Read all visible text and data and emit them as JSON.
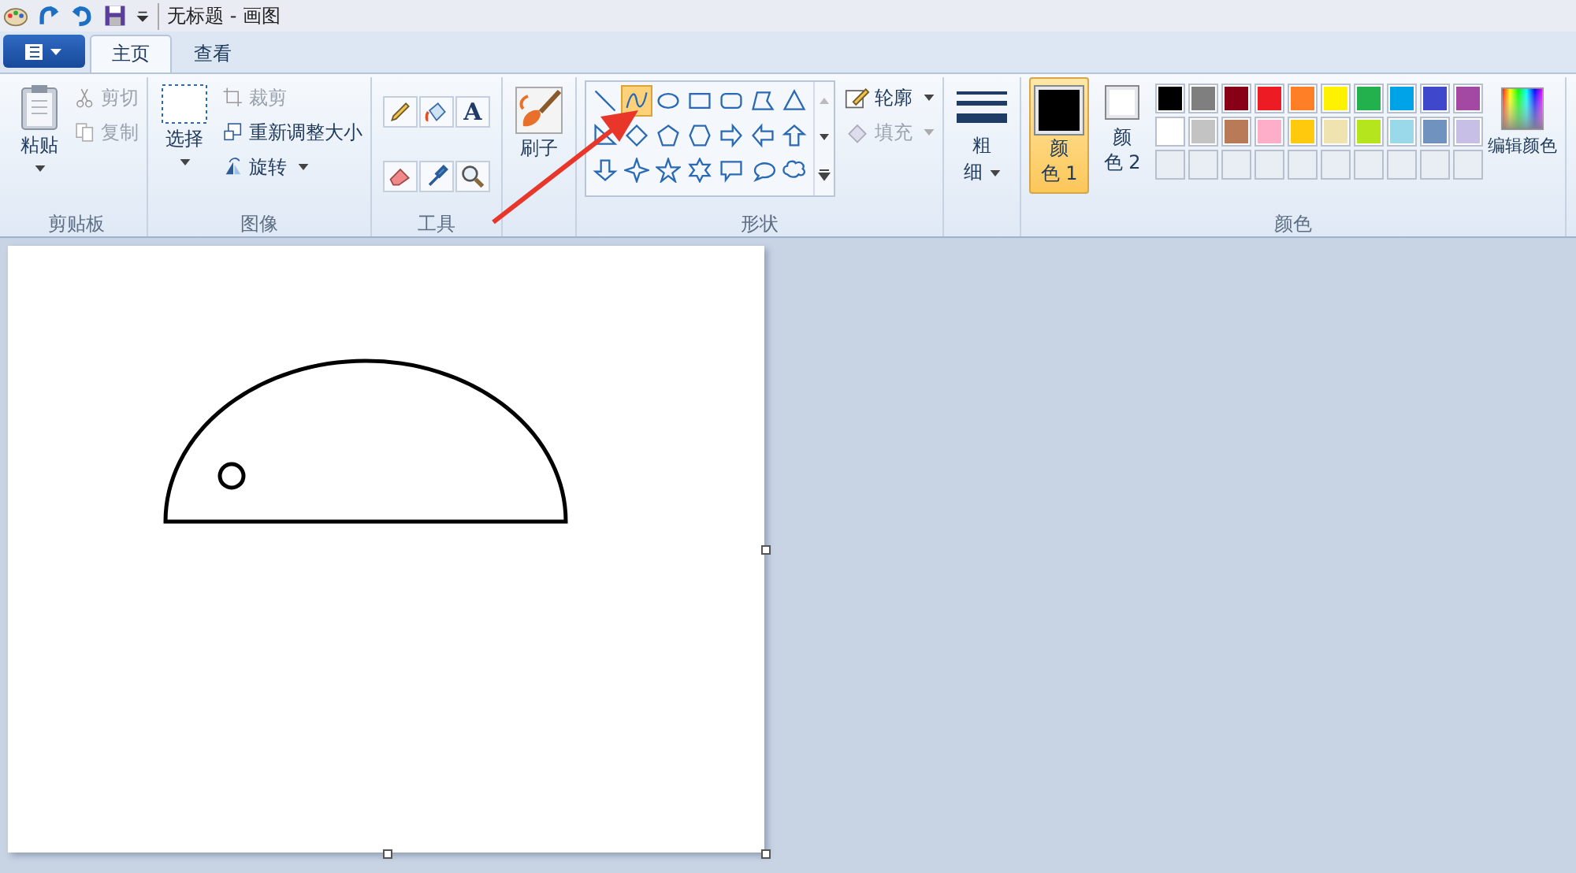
{
  "window": {
    "title": "无标题 - 画图"
  },
  "tabs": [
    {
      "label": "主页",
      "selected": true
    },
    {
      "label": "查看",
      "selected": false
    }
  ],
  "clipboard": {
    "label": "剪贴板",
    "paste": "粘贴",
    "actions": [
      {
        "kind": "cut",
        "label": "剪切",
        "disabled": true
      },
      {
        "kind": "copy",
        "label": "复制",
        "disabled": true
      }
    ]
  },
  "image": {
    "label": "图像",
    "select": "选择",
    "actions": [
      {
        "kind": "crop",
        "label": "裁剪",
        "disabled": true
      },
      {
        "kind": "resize",
        "label": "重新调整大小",
        "disabled": false
      },
      {
        "kind": "rotate",
        "label": "旋转",
        "disabled": false
      }
    ]
  },
  "tools": {
    "label": "工具",
    "items": [
      {
        "kind": "pencil"
      },
      {
        "kind": "bucket"
      },
      {
        "kind": "text",
        "glyph": "A"
      },
      {
        "kind": "eraser"
      },
      {
        "kind": "picker"
      },
      {
        "kind": "magnifier"
      }
    ]
  },
  "brush": {
    "label": "刷子"
  },
  "shapes": {
    "label": "形状",
    "items": [
      {
        "kind": "line",
        "selected": false
      },
      {
        "kind": "curve",
        "selected": true
      },
      {
        "kind": "oval",
        "selected": false
      },
      {
        "kind": "rect",
        "selected": false
      },
      {
        "kind": "roundrect",
        "selected": false
      },
      {
        "kind": "polygon",
        "selected": false
      },
      {
        "kind": "triangle",
        "selected": false
      },
      {
        "kind": "right-triangle",
        "selected": false
      },
      {
        "kind": "diamond",
        "selected": false
      },
      {
        "kind": "pentagon",
        "selected": false
      },
      {
        "kind": "hexagon",
        "selected": false
      },
      {
        "kind": "right-arrow",
        "selected": false
      },
      {
        "kind": "left-arrow",
        "selected": false
      },
      {
        "kind": "up-arrow",
        "selected": false
      },
      {
        "kind": "down-arrow",
        "selected": false
      },
      {
        "kind": "star4",
        "selected": false
      },
      {
        "kind": "star5",
        "selected": false
      },
      {
        "kind": "star6",
        "selected": false
      },
      {
        "kind": "callout-rect",
        "selected": false
      },
      {
        "kind": "callout-oval",
        "selected": false
      },
      {
        "kind": "callout-cloud",
        "selected": false
      }
    ],
    "outline": {
      "label": "轮廓",
      "disabled": false
    },
    "fill": {
      "label": "填充",
      "disabled": true
    }
  },
  "size": {
    "label_top": "粗",
    "label_bottom": "细"
  },
  "colors": {
    "label": "颜色",
    "current": [
      {
        "label_top": "颜",
        "label_bottom": "色 1",
        "color": "#000000",
        "selected": true
      },
      {
        "label_top": "颜",
        "label_bottom": "色 2",
        "color": "#ffffff",
        "selected": false
      }
    ],
    "palette": [
      {
        "color": "#000000"
      },
      {
        "color": "#7f7f7f"
      },
      {
        "color": "#880015"
      },
      {
        "color": "#ed1c24"
      },
      {
        "color": "#ff7f27"
      },
      {
        "color": "#fff200"
      },
      {
        "color": "#22b14c"
      },
      {
        "color": "#00a2e8"
      },
      {
        "color": "#3f48cc"
      },
      {
        "color": "#a349a4"
      },
      {
        "color": "#ffffff"
      },
      {
        "color": "#c3c3c3"
      },
      {
        "color": "#b97a57"
      },
      {
        "color": "#ffaec9"
      },
      {
        "color": "#ffc90e"
      },
      {
        "color": "#efe4b0"
      },
      {
        "color": "#b5e61d"
      },
      {
        "color": "#99d9ea"
      },
      {
        "color": "#7092be"
      },
      {
        "color": "#c8bfe7"
      }
    ],
    "edit": "编辑颜色"
  }
}
